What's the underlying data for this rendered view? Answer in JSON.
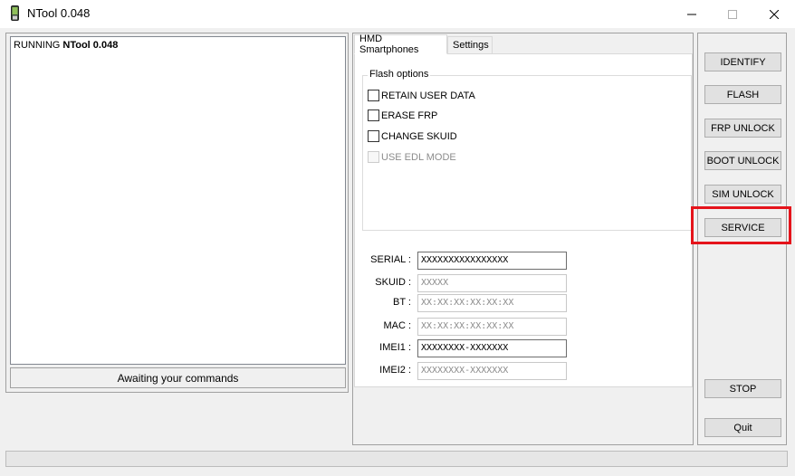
{
  "window": {
    "title": "NTool 0.048",
    "icons": {
      "app": "phone-icon",
      "minimize": "minimize-icon",
      "maximize": "maximize-icon",
      "close": "close-icon"
    }
  },
  "log": {
    "prefix": "RUNNING ",
    "app_name": "NTool 0.048"
  },
  "status": "Awaiting your commands",
  "tabs": [
    {
      "label": "HMD Smartphones",
      "active": true
    },
    {
      "label": "Settings",
      "active": false
    }
  ],
  "flash_options": {
    "legend": "Flash options",
    "items": [
      {
        "label": "RETAIN USER DATA",
        "checked": false,
        "enabled": true
      },
      {
        "label": "ERASE FRP",
        "checked": false,
        "enabled": true
      },
      {
        "label": "CHANGE SKUID",
        "checked": false,
        "enabled": true
      },
      {
        "label": "USE EDL MODE",
        "checked": false,
        "enabled": false
      }
    ]
  },
  "fields": [
    {
      "label": "SERIAL :",
      "value": "XXXXXXXXXXXXXXXX",
      "filled": true
    },
    {
      "label": "SKUID :",
      "value": "XXXXX",
      "filled": false
    },
    {
      "label": "BT :",
      "value": "XX:XX:XX:XX:XX:XX",
      "filled": false
    },
    {
      "label": "MAC :",
      "value": "XX:XX:XX:XX:XX:XX",
      "filled": false
    },
    {
      "label": "IMEI1 :",
      "value": "XXXXXXXX-XXXXXXX",
      "filled": true
    },
    {
      "label": "IMEI2 :",
      "value": "XXXXXXXX-XXXXXXX",
      "filled": false
    }
  ],
  "buttons": {
    "identify": "IDENTIFY",
    "flash": "FLASH",
    "frp_unlock": "FRP UNLOCK",
    "boot_unlock": "BOOT UNLOCK",
    "sim_unlock": "SIM UNLOCK",
    "service": "SERVICE",
    "stop": "STOP",
    "quit": "Quit"
  },
  "highlight_color": "#e5141b",
  "progress": 0
}
